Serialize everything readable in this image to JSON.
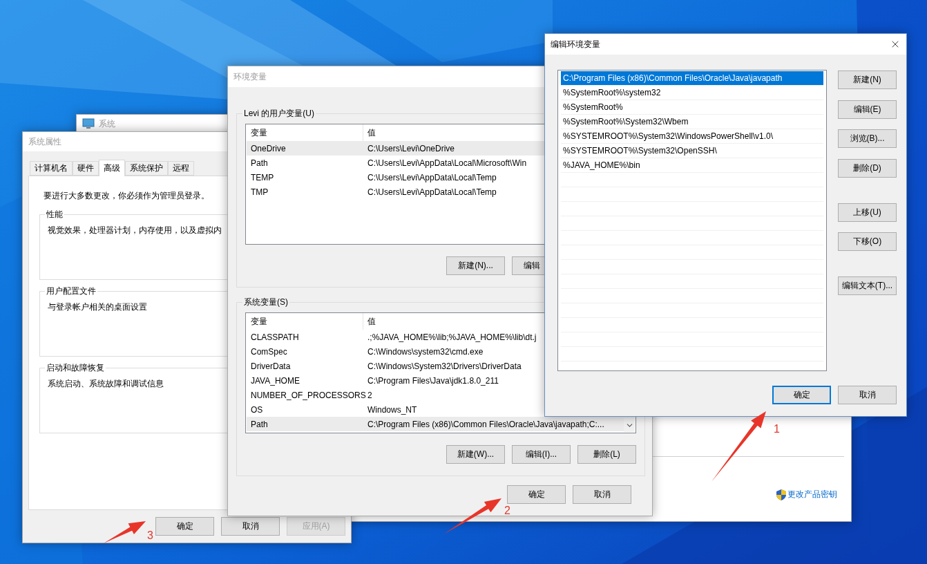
{
  "system_window": {
    "title": "系统",
    "link": "更改产品密钥"
  },
  "system_properties": {
    "title": "系统属性",
    "tabs": [
      {
        "label": "计算机名",
        "selected": false
      },
      {
        "label": "硬件",
        "selected": false
      },
      {
        "label": "高级",
        "selected": true
      },
      {
        "label": "系统保护",
        "selected": false
      },
      {
        "label": "远程",
        "selected": false
      }
    ],
    "notice": "要进行大多数更改，你必须作为管理员登录。",
    "groups": [
      {
        "title": "性能",
        "text": "视觉效果，处理器计划，内存使用，以及虚拟内"
      },
      {
        "title": "用户配置文件",
        "text": "与登录帐户相关的桌面设置"
      },
      {
        "title": "启动和故障恢复",
        "text": "系统启动、系统故障和调试信息"
      }
    ],
    "buttons": [
      {
        "label": "确定",
        "disabled": false
      },
      {
        "label": "取消",
        "disabled": false
      },
      {
        "label": "应用(A)",
        "disabled": true
      }
    ]
  },
  "environment_variables": {
    "title": "环境变量",
    "user_variables": {
      "title": "Levi 的用户变量(U)",
      "columns": [
        "变量",
        "值"
      ],
      "rows": [
        {
          "name": "OneDrive",
          "value": "C:\\Users\\Levi\\OneDrive",
          "selected": true
        },
        {
          "name": "Path",
          "value": "C:\\Users\\Levi\\AppData\\Local\\Microsoft\\Win",
          "selected": false
        },
        {
          "name": "TEMP",
          "value": "C:\\Users\\Levi\\AppData\\Local\\Temp",
          "selected": false
        },
        {
          "name": "TMP",
          "value": "C:\\Users\\Levi\\AppData\\Local\\Temp",
          "selected": false
        }
      ],
      "buttons": [
        "新建(N)...",
        "编辑"
      ]
    },
    "system_variables": {
      "title": "系统变量(S)",
      "columns": [
        "变量",
        "值"
      ],
      "rows": [
        {
          "name": "CLASSPATH",
          "value": ".;%JAVA_HOME%\\lib;%JAVA_HOME%\\lib\\dt.j",
          "selected": false
        },
        {
          "name": "ComSpec",
          "value": "C:\\Windows\\system32\\cmd.exe",
          "selected": false
        },
        {
          "name": "DriverData",
          "value": "C:\\Windows\\System32\\Drivers\\DriverData",
          "selected": false
        },
        {
          "name": "JAVA_HOME",
          "value": "C:\\Program Files\\Java\\jdk1.8.0_211",
          "selected": false
        },
        {
          "name": "NUMBER_OF_PROCESSORS",
          "value": "2",
          "selected": false
        },
        {
          "name": "OS",
          "value": "Windows_NT",
          "selected": false
        },
        {
          "name": "Path",
          "value": "C:\\Program Files (x86)\\Common Files\\Oracle\\Java\\javapath;C:...",
          "selected": true
        }
      ],
      "buttons": [
        "新建(W)...",
        "编辑(I)...",
        "删除(L)"
      ]
    },
    "buttons": [
      "确定",
      "取消"
    ]
  },
  "edit_window": {
    "title": "编辑环境变量",
    "entries": [
      {
        "text": "C:\\Program Files (x86)\\Common Files\\Oracle\\Java\\javapath",
        "selected": true
      },
      {
        "text": "%SystemRoot%\\system32",
        "selected": false
      },
      {
        "text": "%SystemRoot%",
        "selected": false
      },
      {
        "text": "%SystemRoot%\\System32\\Wbem",
        "selected": false
      },
      {
        "text": "%SYSTEMROOT%\\System32\\WindowsPowerShell\\v1.0\\",
        "selected": false
      },
      {
        "text": "%SYSTEMROOT%\\System32\\OpenSSH\\",
        "selected": false
      },
      {
        "text": "%JAVA_HOME%\\bin",
        "selected": false
      }
    ],
    "button_groups": [
      [
        "新建(N)",
        "编辑(E)",
        "浏览(B)...",
        "删除(D)"
      ],
      [
        "上移(U)",
        "下移(O)"
      ],
      [
        "编辑文本(T)..."
      ]
    ],
    "buttons": [
      {
        "label": "确定",
        "default": true
      },
      {
        "label": "取消",
        "default": false
      }
    ]
  },
  "annotations": [
    {
      "label": "1"
    },
    {
      "label": "2"
    },
    {
      "label": "3"
    }
  ]
}
